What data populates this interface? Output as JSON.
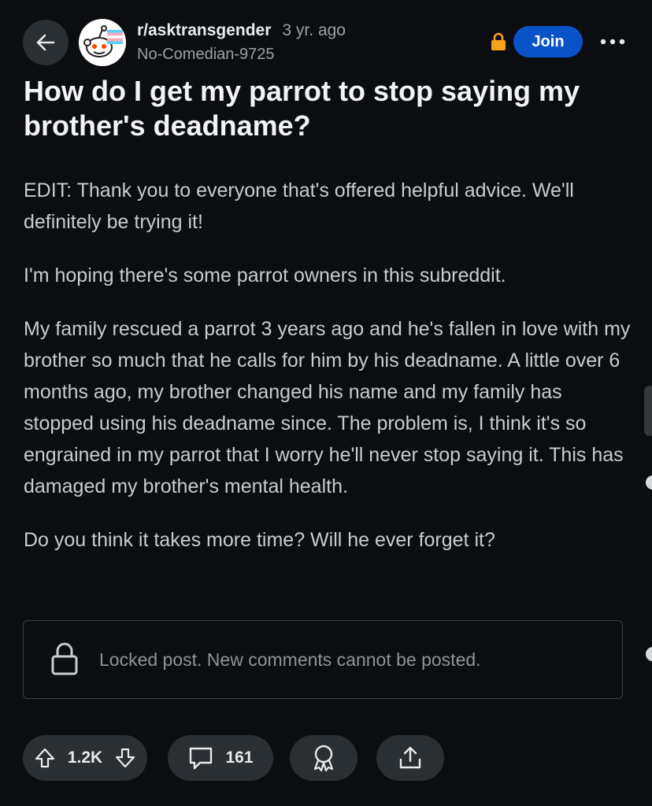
{
  "header": {
    "back_icon": "arrow-left-icon",
    "subreddit": "r/asktransgender",
    "age": "3 yr. ago",
    "username": "No-Comedian-9725",
    "lock_icon": "lock-icon",
    "join_label": "Join",
    "more_icon": "more-horizontal-icon",
    "more_label": "•••",
    "join_color": "#0a52c7",
    "lock_color": "#f4a21a"
  },
  "post": {
    "title": "How do I get my parrot to stop saying my brother's deadname?",
    "paragraphs": [
      "EDIT: Thank you to everyone that's offered helpful advice. We'll definitely be trying it!",
      "I'm hoping there's some parrot owners in this subreddit.",
      "My family rescued a parrot 3 years ago and he's fallen in love with my brother so much that he calls for him by his deadname. A little over 6 months ago, my brother changed his name and my family has stopped using his deadname since. The problem is, I think it's so engrained in my parrot that I worry he'll never stop saying it. This has damaged my brother's mental health.",
      "Do you think it takes more time? Will he ever forget it?"
    ]
  },
  "locked_notice": {
    "icon": "lock-icon",
    "text": "Locked post. New comments cannot be posted."
  },
  "actions": {
    "upvote_icon": "upvote-arrow-icon",
    "score": "1.2K",
    "downvote_icon": "downvote-arrow-icon",
    "comment_icon": "comment-bubble-icon",
    "comments": "161",
    "award_icon": "award-icon",
    "share_icon": "share-icon"
  }
}
